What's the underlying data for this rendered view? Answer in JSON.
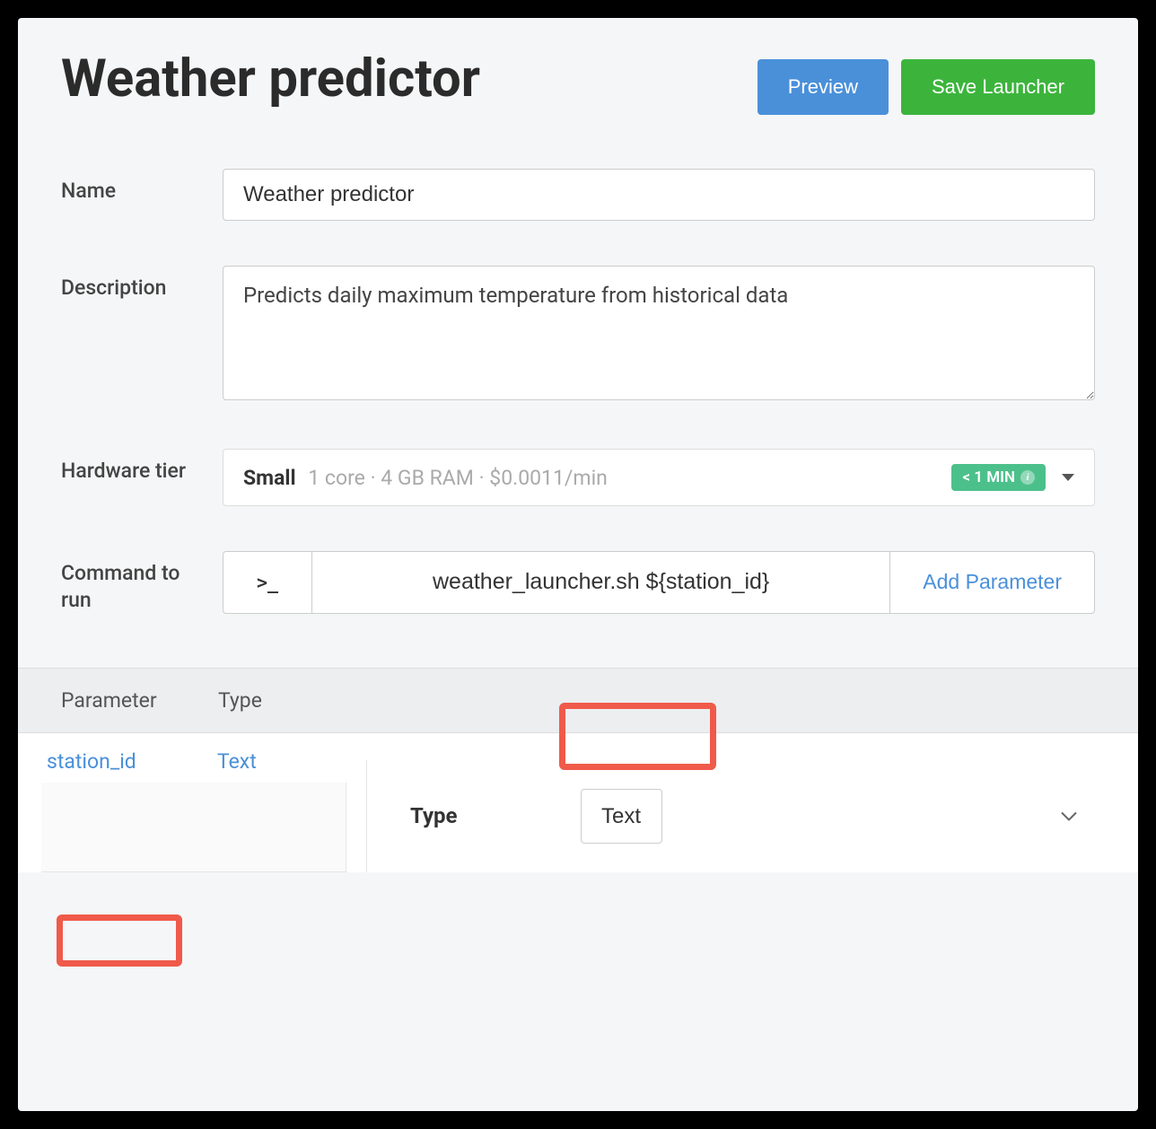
{
  "title": "Weather predictor",
  "buttons": {
    "preview": "Preview",
    "save": "Save Launcher"
  },
  "form": {
    "name_label": "Name",
    "name_value": "Weather predictor",
    "description_label": "Description",
    "description_value": "Predicts daily maximum temperature from historical data",
    "hardware_label": "Hardware tier",
    "hardware": {
      "name": "Small",
      "specs": "1 core · 4 GB RAM · $0.0011/min",
      "badge": "< 1 MIN"
    },
    "command_label": "Command to run",
    "command_value": "weather_launcher.sh ${station_id}",
    "add_param": "Add Parameter"
  },
  "params": {
    "header_parameter": "Parameter",
    "header_type": "Type",
    "row": {
      "name": "station_id",
      "type": "Text"
    },
    "detail": {
      "type_label": "Type",
      "type_value": "Text"
    }
  }
}
